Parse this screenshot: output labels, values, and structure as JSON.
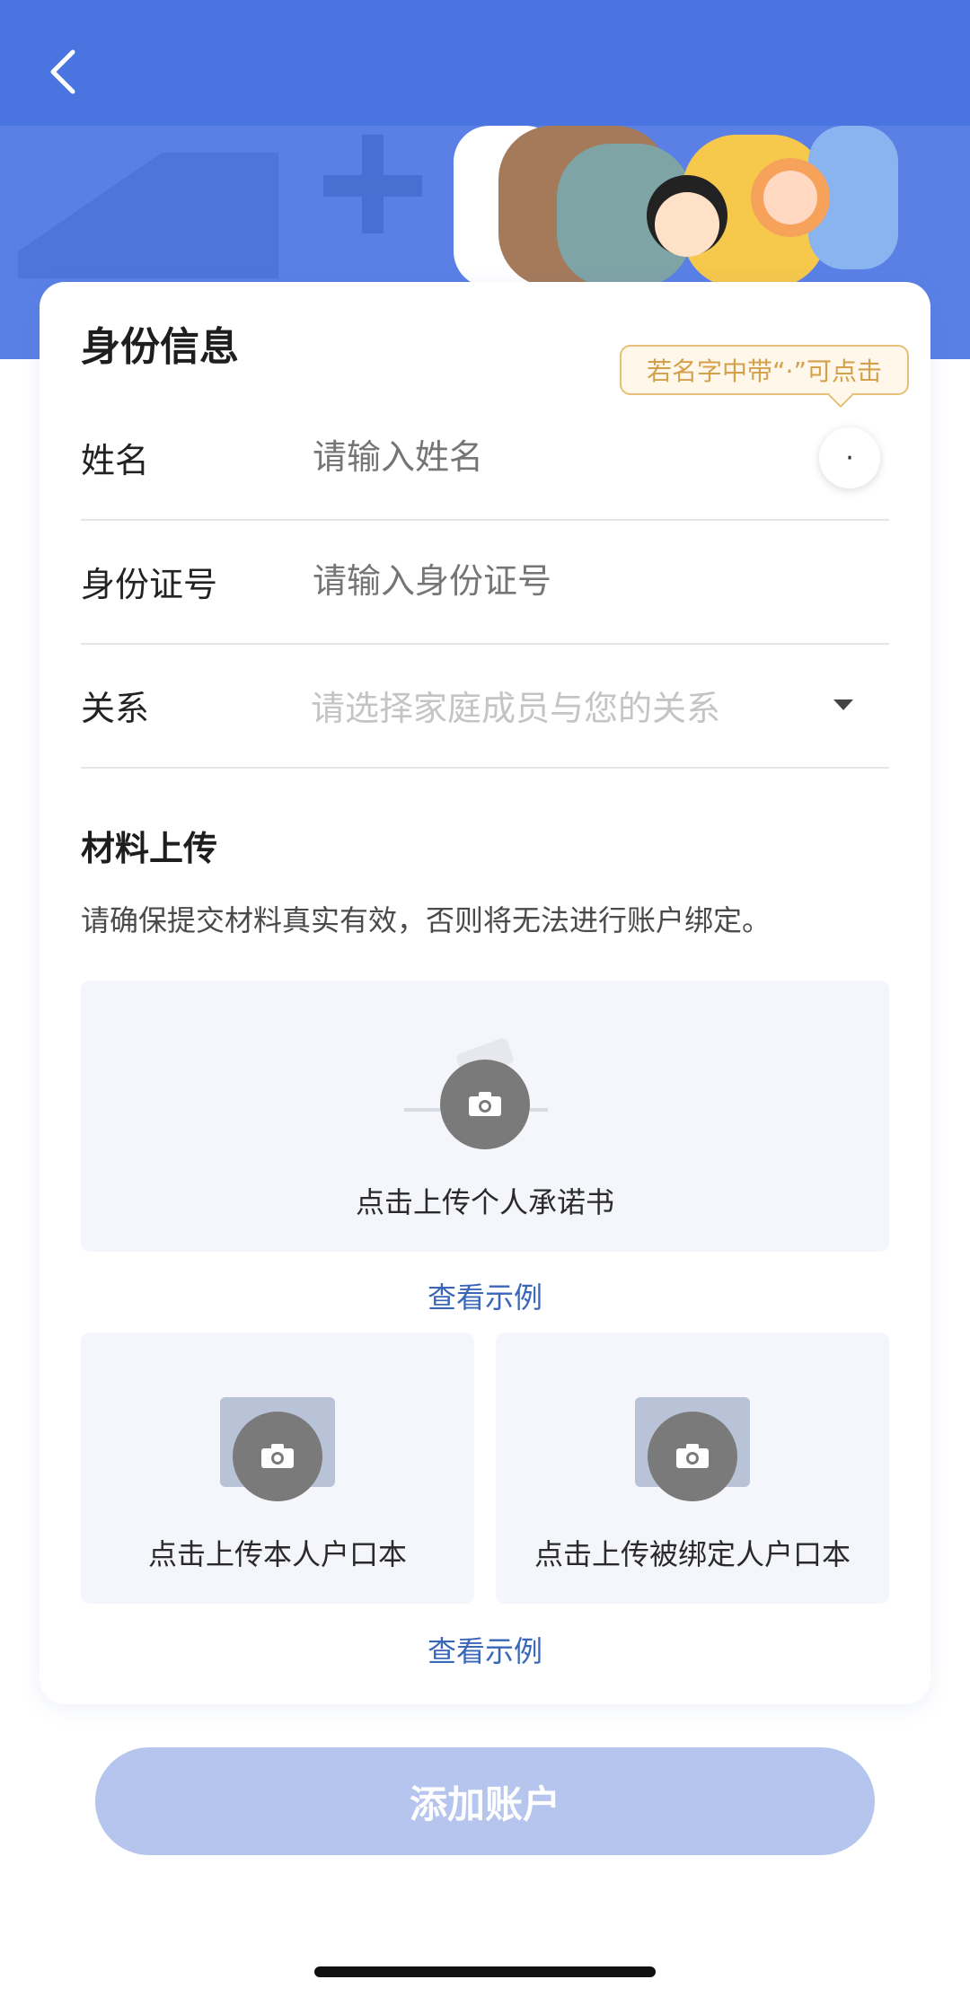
{
  "colors": {
    "header_blue": "#4a74e0",
    "hero_blue": "#5a80e6",
    "link_blue": "#3a66b8",
    "button_disabled": "#b6c5ee",
    "tip_gold": "#d4a04c"
  },
  "header": {
    "back_icon": "chevron-left-icon"
  },
  "identity": {
    "title": "身份信息",
    "tip": "若名字中带“·”可点击",
    "dot_button": "·",
    "name": {
      "label": "姓名",
      "placeholder": "请输入姓名"
    },
    "id_number": {
      "label": "身份证号",
      "placeholder": "请输入身份证号"
    },
    "relation": {
      "label": "关系",
      "placeholder": "请选择家庭成员与您的关系"
    }
  },
  "materials": {
    "title": "材料上传",
    "description": "请确保提交材料真实有效，否则将无法进行账户绑定。",
    "pledge_upload": "点击上传个人承诺书",
    "example_link_1": "查看示例",
    "own_hukou_upload": "点击上传本人户口本",
    "bound_hukou_upload": "点击上传被绑定人户口本",
    "example_link_2": "查看示例"
  },
  "submit": {
    "label": "添加账户"
  }
}
